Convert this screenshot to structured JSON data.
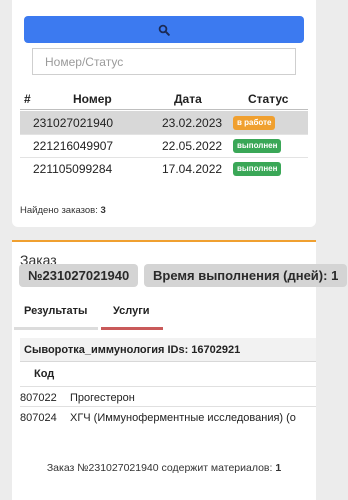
{
  "search": {
    "button_icon": "search-icon",
    "placeholder": "Номер/Статус"
  },
  "orders_table": {
    "headers": [
      "#",
      "Номер",
      "Дата",
      "Статус"
    ],
    "rows": [
      {
        "number": "231027021940",
        "date": "23.02.2023",
        "status": "в работе",
        "status_color": "#f0a030",
        "selected": true
      },
      {
        "number": "221216049907",
        "date": "22.05.2022",
        "status": "выполнен",
        "status_color": "#3aa757",
        "selected": false
      },
      {
        "number": "221105099284",
        "date": "17.04.2022",
        "status": "выполнен",
        "status_color": "#3aa757",
        "selected": false
      }
    ]
  },
  "found": {
    "label": "Найдено заказов: ",
    "count": "3"
  },
  "order": {
    "title": "Заказ",
    "number_pill": "№231027021940",
    "time_pill": "Время выполнения (дней): 1",
    "tabs": [
      {
        "label": "Результаты",
        "active": false
      },
      {
        "label": "Услуги",
        "active": true
      }
    ],
    "services_group": "Сыворотка_иммунология IDs: 16702921",
    "col_code": "Код",
    "services": [
      {
        "code": "807022",
        "name": "Прогестерон"
      },
      {
        "code": "807024",
        "name": "ХГЧ (Иммуноферментные исследования) (о"
      }
    ],
    "summary_prefix": "Заказ №231027021940 содержит материалов: ",
    "summary_count": "1"
  },
  "colors": {
    "accent_blue": "#3c7af0",
    "accent_orange": "#f0a030",
    "status_green": "#3aa757",
    "tab_underline": "#c95a5a"
  }
}
